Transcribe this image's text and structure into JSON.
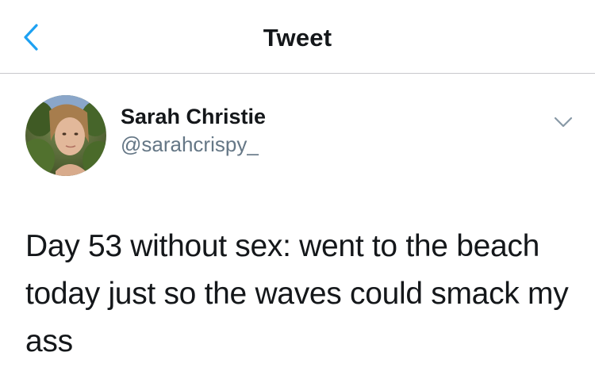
{
  "nav": {
    "title": "Tweet",
    "back_icon": "chevron-left-icon"
  },
  "author": {
    "display_name": "Sarah Christie",
    "handle": "@sarahcrispy_"
  },
  "tweet": {
    "text": "Day 53 without sex: went to the beach today just so the waves could smack my ass"
  },
  "colors": {
    "accent": "#1da1f2",
    "text_primary": "#14171a",
    "text_secondary": "#657786",
    "divider": "#c8c8cc"
  }
}
